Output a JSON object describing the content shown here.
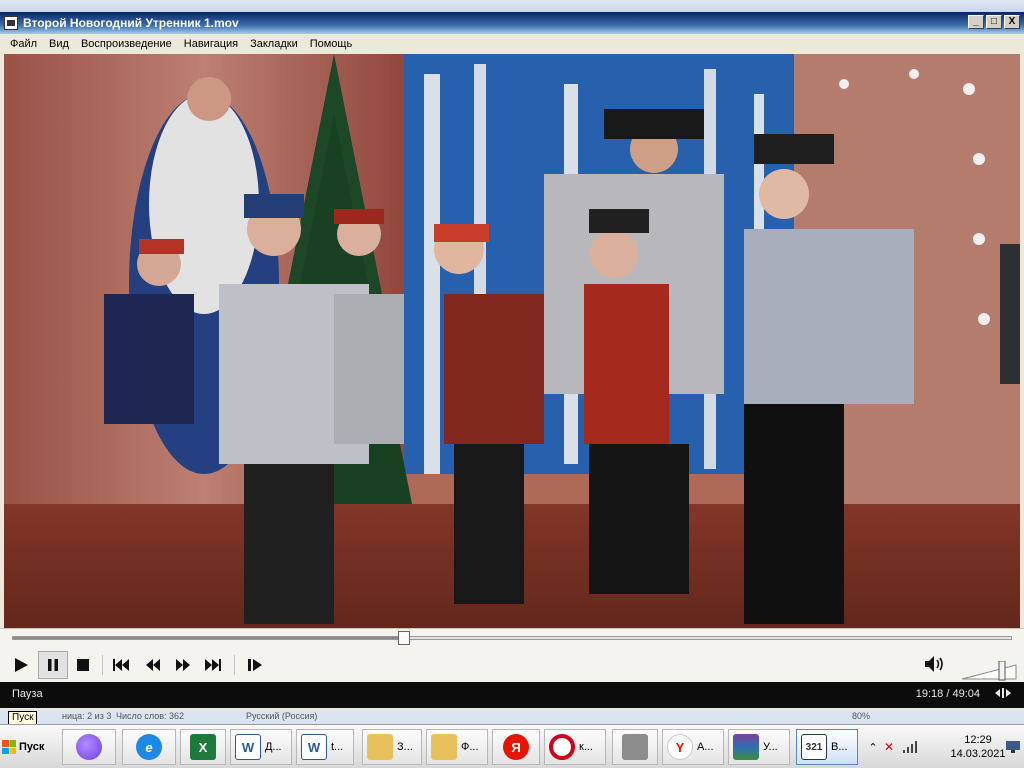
{
  "player": {
    "title": "Второй Новогодний Утренник 1.mov",
    "window_buttons": {
      "minimize": "_",
      "maximize": "□",
      "close": "X"
    },
    "menu": [
      "Файл",
      "Вид",
      "Воспроизведение",
      "Навигация",
      "Закладки",
      "Помощь"
    ],
    "progress": 0.391,
    "status": "Пауза",
    "time": "19:18 / 49:04",
    "volume": 0.8,
    "icons": {
      "play": "play-icon",
      "pause": "pause-icon",
      "stop": "stop-icon",
      "prev": "skip-back-icon",
      "rew": "rewind-icon",
      "ffw": "fast-forward-icon",
      "next": "skip-forward-icon",
      "step": "frame-step-icon",
      "volume": "speaker-icon",
      "fullscreen": "fullscreen-icon"
    }
  },
  "word_status": {
    "tooltip": "Пуск",
    "page": "ница: 2 из 3",
    "words": "Число слов: 362",
    "lang": "Русский (Россия)",
    "zoom": "80%"
  },
  "taskbar": {
    "start_label": "Пуск",
    "buttons": [
      {
        "label": "Д...",
        "icon": "word-icon"
      },
      {
        "label": "t...",
        "icon": "word-icon"
      },
      {
        "label": "З...",
        "icon": "folder-icon"
      },
      {
        "label": "Ф...",
        "icon": "folder-icon"
      },
      {
        "label": "к...",
        "icon": "opera-icon"
      },
      {
        "label": "A...",
        "icon": "yandex-browser-icon"
      },
      {
        "label": "У...",
        "icon": "winrar-icon"
      },
      {
        "label": "В...",
        "icon": "media-player-icon"
      }
    ],
    "pinned": [
      "alice-icon",
      "ie-icon",
      "excel-icon",
      "yandex-icon",
      "printer-icon"
    ],
    "clock": {
      "time": "12:29",
      "date": "14.03.2021"
    },
    "tray": [
      "show-hidden-icon",
      "volume-muted-icon",
      "signal-icon",
      "monitor-icon"
    ]
  },
  "colors": {
    "title_gradient_start": "#0a246a",
    "title_gradient_end": "#a6caf0",
    "status_bg": "#0c0c0c",
    "opera_red": "#d0021b",
    "yandex_red": "#e61400"
  }
}
